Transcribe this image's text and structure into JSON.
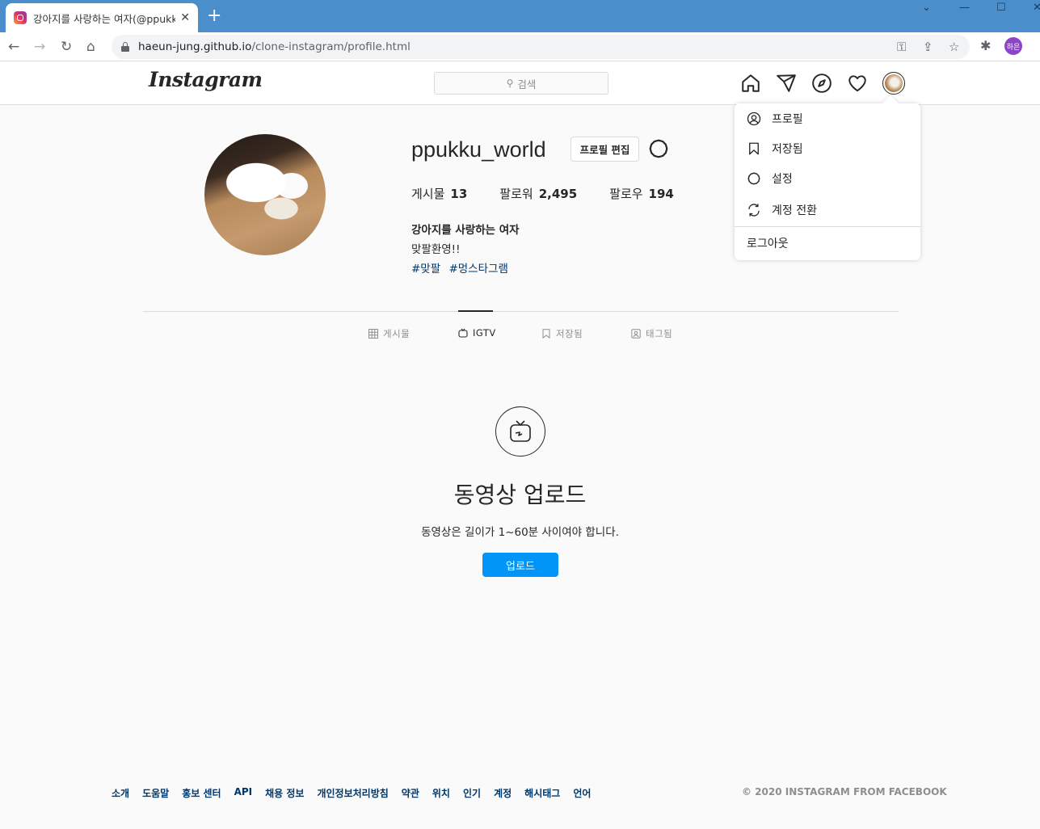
{
  "browser": {
    "tab_title": "강아지를 사랑하는 여자(@ppukk",
    "tab_close": "✕",
    "new_tab": "+",
    "url_host": "haeun-jung.github.io",
    "url_path": "/clone-instagram/profile.html",
    "profile_chip": "하은"
  },
  "header": {
    "logo": "Instagram",
    "search_placeholder": "검색"
  },
  "dropdown": {
    "items": [
      {
        "label": "프로필",
        "icon": "user-circle-icon"
      },
      {
        "label": "저장됨",
        "icon": "bookmark-icon"
      },
      {
        "label": "설정",
        "icon": "gear-icon"
      },
      {
        "label": "계정 전환",
        "icon": "switch-icon"
      }
    ],
    "logout": "로그아웃"
  },
  "profile": {
    "username": "ppukku_world",
    "edit_label": "프로필 편집",
    "stats": [
      {
        "label": "게시물",
        "value": "13"
      },
      {
        "label": "팔로워",
        "value": "2,495"
      },
      {
        "label": "팔로우",
        "value": "194"
      }
    ],
    "bio_name": "강아지를 사랑하는 여자",
    "bio_text": "맞팔환영!!",
    "tags": [
      "#맞팔",
      "#멍스타그램"
    ]
  },
  "tabs": [
    {
      "label": "게시물",
      "active": false
    },
    {
      "label": "IGTV",
      "active": true
    },
    {
      "label": "저장됨",
      "active": false
    },
    {
      "label": "태그됨",
      "active": false
    }
  ],
  "igtv": {
    "title": "동영상 업로드",
    "description": "동영상은 길이가 1~60분 사이여야 합니다.",
    "button": "업로드"
  },
  "footer": {
    "links": [
      "소개",
      "도움말",
      "홍보 센터",
      "API",
      "채용 정보",
      "개인정보처리방침",
      "약관",
      "위치",
      "인기",
      "계정",
      "해시태그",
      "언어"
    ],
    "copyright": "© 2020 INSTAGRAM FROM FACEBOOK"
  },
  "colors": {
    "tabbar": "#4a8ecb",
    "accent": "#0095f6",
    "link": "#00376b"
  }
}
